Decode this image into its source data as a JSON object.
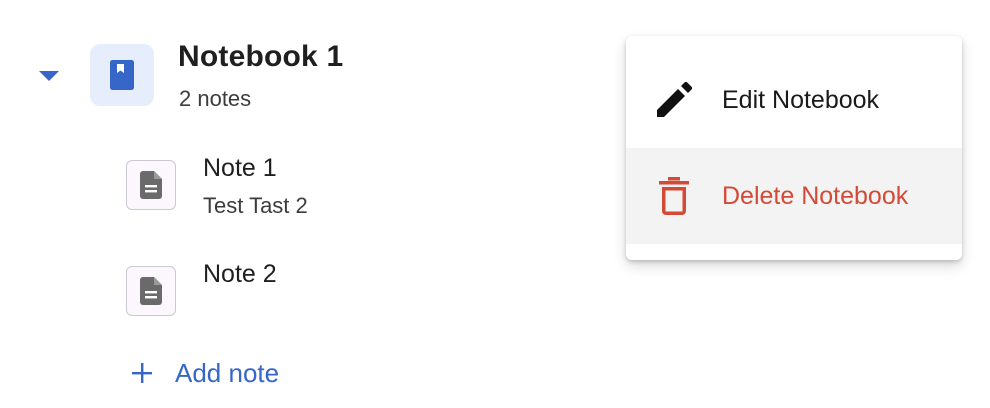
{
  "notebook": {
    "title": "Notebook 1",
    "count": "2 notes",
    "expand_icon": "caret-down-icon",
    "avatar_icon": "book-icon"
  },
  "notes": [
    {
      "title": "Note 1",
      "snippet": "Test Tast 2",
      "icon": "document-icon"
    },
    {
      "title": "Note 2",
      "snippet": "",
      "icon": "document-icon"
    }
  ],
  "add_note": {
    "label": "Add note",
    "icon": "plus-icon"
  },
  "menu": {
    "items": [
      {
        "label": "Edit Notebook",
        "icon": "pencil-icon"
      },
      {
        "label": "Delete Notebook",
        "icon": "trash-icon"
      }
    ]
  },
  "colors": {
    "accent": "#3566c8",
    "book_icon": "#3566c8",
    "danger": "#d34a36",
    "avatar_bg": "#e6eefb",
    "hover_bg": "#f3f3f3"
  }
}
